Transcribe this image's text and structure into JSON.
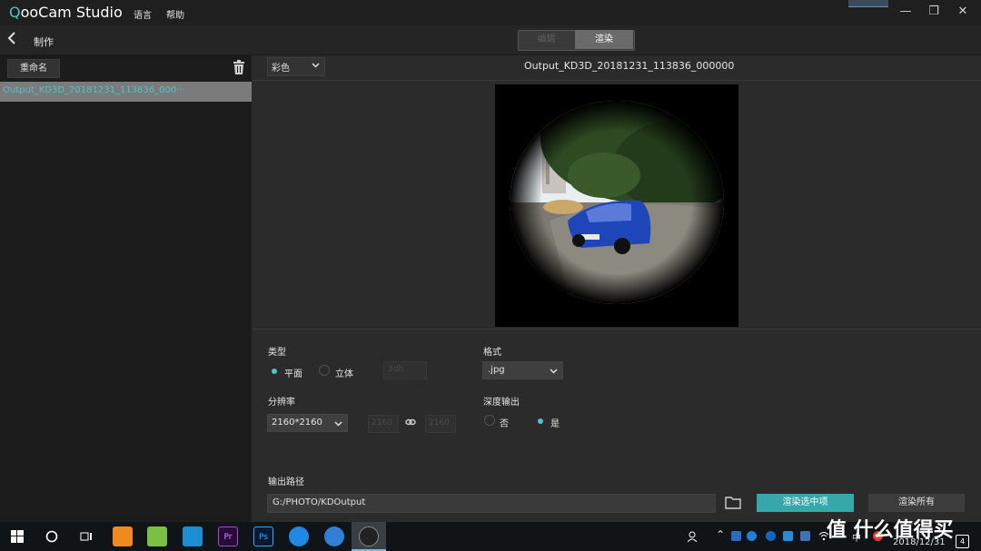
{
  "app": {
    "logo_q": "Q",
    "logo_rest": "ooCam Studio",
    "menu": [
      "语言",
      "帮助"
    ]
  },
  "window_controls": {
    "minimize": "—",
    "maximize": "❐",
    "close": "✕"
  },
  "toolbar": {
    "back_icon": "chevron-left-icon",
    "section_label": "制作",
    "tabs": [
      {
        "label": "编辑",
        "active": false
      },
      {
        "label": "渲染",
        "active": true
      }
    ]
  },
  "left_panel": {
    "rename_button": "重命名",
    "delete_icon": "trash-icon",
    "files": [
      {
        "name": "Output_KD3D_20181231_113836_000···",
        "selected": true
      }
    ]
  },
  "preview": {
    "color_mode": "彩色",
    "output_name": "Output_KD3D_20181231_113836_000000"
  },
  "settings": {
    "type_label": "类型",
    "type_options": [
      {
        "label": "平面",
        "selected": true
      },
      {
        "label": "立体",
        "selected": false
      }
    ],
    "type_disabled_select": "3dh",
    "format_label": "格式",
    "format_value": ".jpg",
    "resolution_label": "分辨率",
    "resolution_value": "2160*2160",
    "width_value": "2160",
    "height_value": "2160",
    "link_icon": "link-icon",
    "depth_label": "深度输出",
    "depth_options": [
      {
        "label": "否",
        "selected": false
      },
      {
        "label": "是",
        "selected": true
      }
    ],
    "output_path_label": "输出路径",
    "output_path": "G:/PHOTO/KDOutput",
    "render_selected_button": "渲染选中项",
    "render_all_button": "渲染所有"
  },
  "taskbar": {
    "apps": [
      "windows-start-icon",
      "cortana-icon",
      "task-view-icon",
      "uc-browser-icon",
      "android-icon",
      "camera-app-icon",
      "premiere-icon",
      "photoshop-icon",
      "edge-icon",
      "feather-app-icon",
      "qoocam-icon"
    ],
    "premiere_label": "Pr",
    "photoshop_label": "Ps",
    "ime": "中",
    "date": "2018/12/31",
    "notification_count": "4",
    "watermark": "值 什么值得买"
  },
  "colors": {
    "accent": "#37a7ab",
    "accent_text": "#4fc3c9",
    "background": "#2b2b2b",
    "sidebar": "#1c1c1c"
  }
}
